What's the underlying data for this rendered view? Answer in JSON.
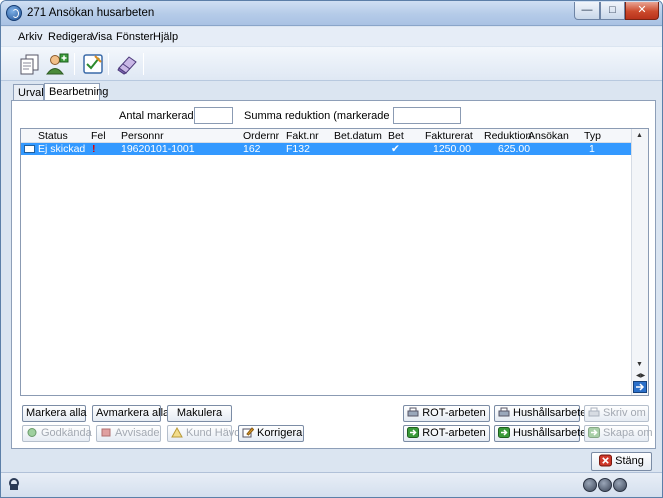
{
  "window": {
    "title": "271 Ansökan husarbeten"
  },
  "menu": {
    "items": [
      "Arkiv",
      "Redigera",
      "Visa",
      "Fönster",
      "Hjälp"
    ]
  },
  "tabs": [
    "Urval",
    "Bearbetning"
  ],
  "summary": {
    "antal_label": "Antal markerade:",
    "antal_value": "",
    "summa_label": "Summa reduktion (markerade rader):",
    "summa_value": ""
  },
  "grid": {
    "columns": [
      "Status",
      "Fel",
      "Personnr",
      "Ordernr",
      "Fakt.nr",
      "Bet.datum",
      "Bet",
      "Fakturerat",
      "Reduktion",
      "Ansökan",
      "Typ"
    ],
    "rows": [
      {
        "status": "Ej skickad",
        "fel": "!",
        "personnr": "19620101-1001",
        "ordernr": "162",
        "faktnr": "F132",
        "betdatum": "",
        "bet": "✔",
        "fakturerat": "1250.00",
        "reduktion": "625.00",
        "ansokan": "",
        "typ": "1"
      }
    ]
  },
  "buttons": {
    "markera_alla": "Markera alla",
    "avmarkera_alla": "Avmarkera alla",
    "makulera": "Makulera",
    "godkanda": "Godkända",
    "avvisade": "Avvisade",
    "kund_havd": "Kund Hävd",
    "korrigera": "Korrigera",
    "rot_arbeten_1": "ROT-arbeten",
    "hushall_arbeten_1": "Hushållsarbeten",
    "skriv_om": "Skriv om",
    "rot_arbeten_2": "ROT-arbeten",
    "hushall_arbeten_2": "Hushållsarbeten",
    "skapa_om": "Skapa om",
    "stang": "Stäng"
  },
  "colors": {
    "selection": "#3399ff",
    "error": "#e00000"
  }
}
